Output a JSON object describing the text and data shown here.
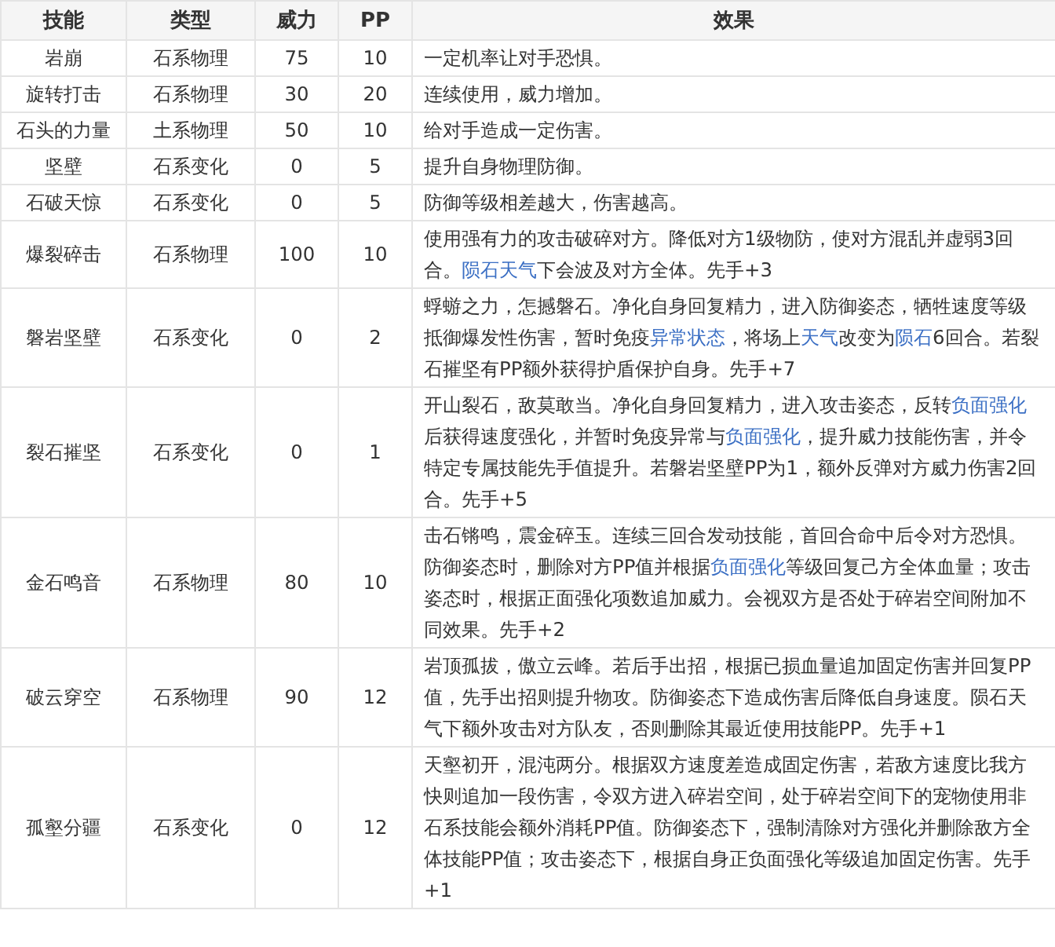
{
  "table": {
    "columns": [
      "技能",
      "类型",
      "威力",
      "PP",
      "效果"
    ],
    "rows": [
      {
        "cells": [
          "岩崩",
          "石系物理",
          "75",
          "10"
        ],
        "effect": [
          {
            "kind": "text",
            "text": "一定机率让对手恐惧。"
          }
        ]
      },
      {
        "cells": [
          "旋转打击",
          "石系物理",
          "30",
          "20"
        ],
        "effect": [
          {
            "kind": "text",
            "text": "连续使用，威力增加。"
          }
        ]
      },
      {
        "cells": [
          "石头的力量",
          "土系物理",
          "50",
          "10"
        ],
        "effect": [
          {
            "kind": "text",
            "text": "给对手造成一定伤害。"
          }
        ]
      },
      {
        "cells": [
          "坚壁",
          "石系变化",
          "0",
          "5"
        ],
        "effect": [
          {
            "kind": "text",
            "text": "提升自身物理防御。"
          }
        ]
      },
      {
        "cells": [
          "石破天惊",
          "石系变化",
          "0",
          "5"
        ],
        "effect": [
          {
            "kind": "text",
            "text": "防御等级相差越大，伤害越高。"
          }
        ]
      },
      {
        "cells": [
          "爆裂碎击",
          "石系物理",
          "100",
          "10"
        ],
        "effect": [
          {
            "kind": "text",
            "text": "使用强有力的攻击破碎对方。降低对方1级物防，使对方混乱并虚弱3回合。"
          },
          {
            "kind": "link",
            "text": "陨石天气"
          },
          {
            "kind": "text",
            "text": "下会波及对方全体。先手+3"
          }
        ]
      },
      {
        "cells": [
          "磐岩坚壁",
          "石系变化",
          "0",
          "2"
        ],
        "effect": [
          {
            "kind": "text",
            "text": "蜉蝣之力，怎撼磐石。净化自身回复精力，进入防御姿态，牺牲速度等级抵御爆发性伤害，暂时免疫"
          },
          {
            "kind": "link",
            "text": "异常状态"
          },
          {
            "kind": "text",
            "text": "，将场上"
          },
          {
            "kind": "link",
            "text": "天气"
          },
          {
            "kind": "text",
            "text": "改变为"
          },
          {
            "kind": "link",
            "text": "陨石"
          },
          {
            "kind": "text",
            "text": "6回合。若裂石摧坚有PP额外获得护盾保护自身。先手+7"
          }
        ]
      },
      {
        "cells": [
          "裂石摧坚",
          "石系变化",
          "0",
          "1"
        ],
        "effect": [
          {
            "kind": "text",
            "text": "开山裂石，敌莫敢当。净化自身回复精力，进入攻击姿态，反转"
          },
          {
            "kind": "link",
            "text": "负面强化"
          },
          {
            "kind": "text",
            "text": "后获得速度强化，并暂时免疫异常与"
          },
          {
            "kind": "link",
            "text": "负面强化"
          },
          {
            "kind": "text",
            "text": "，提升威力技能伤害，并令特定专属技能先手值提升。若磐岩坚壁PP为1，额外反弹对方威力伤害2回合。先手+5"
          }
        ]
      },
      {
        "cells": [
          "金石鸣音",
          "石系物理",
          "80",
          "10"
        ],
        "effect": [
          {
            "kind": "text",
            "text": "击石锵鸣，震金碎玉。连续三回合发动技能，首回合命中后令对方恐惧。防御姿态时，删除对方PP值并根据"
          },
          {
            "kind": "link",
            "text": "负面强化"
          },
          {
            "kind": "text",
            "text": "等级回复己方全体血量；攻击姿态时，根据正面强化项数追加威力。会视双方是否处于碎岩空间附加不同效果。先手+2"
          }
        ]
      },
      {
        "cells": [
          "破云穿空",
          "石系物理",
          "90",
          "12"
        ],
        "effect": [
          {
            "kind": "text",
            "text": "岩顶孤拔，傲立云峰。若后手出招，根据已损血量追加固定伤害并回复PP值，先手出招则提升物攻。防御姿态下造成伤害后降低自身速度。陨石天气下额外攻击对方队友，否则删除其最近使用技能PP。先手+1"
          }
        ]
      },
      {
        "cells": [
          "孤壑分疆",
          "石系变化",
          "0",
          "12"
        ],
        "effect": [
          {
            "kind": "text",
            "text": "天壑初开，混沌两分。根据双方速度差造成固定伤害，若敌方速度比我方快则追加一段伤害，令双方进入碎岩空间，处于碎岩空间下的宠物使用非石系技能会额外消耗PP值。防御姿态下，强制清除对方强化并删除敌方全体技能PP值；攻击姿态下，根据自身正负面强化等级追加固定伤害。先手+1"
          }
        ]
      }
    ]
  }
}
